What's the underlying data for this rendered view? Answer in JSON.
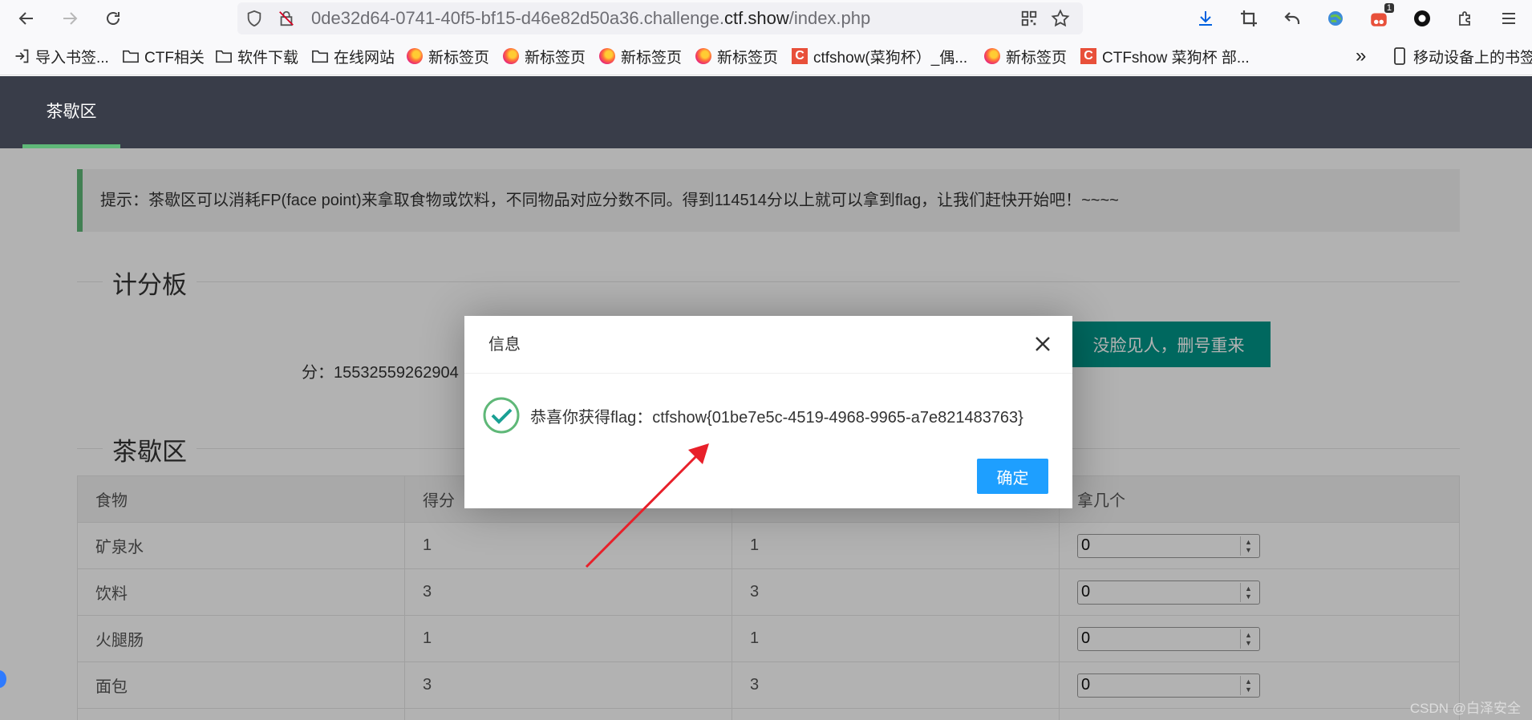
{
  "browser": {
    "url_prefix": "0de32d64-0741-40f5-bf15-d46e82d50a36.challenge.",
    "url_domain": "ctf.show",
    "url_path": "/index.php",
    "extension_badge": "1"
  },
  "bookmarks": {
    "items": [
      {
        "label": "导入书签...",
        "icon": "import-icon"
      },
      {
        "label": "CTF相关",
        "icon": "folder-icon"
      },
      {
        "label": "软件下载",
        "icon": "folder-icon"
      },
      {
        "label": "在线网站",
        "icon": "folder-icon"
      },
      {
        "label": "新标签页",
        "icon": "firefox-icon"
      },
      {
        "label": "新标签页",
        "icon": "firefox-icon"
      },
      {
        "label": "新标签页",
        "icon": "firefox-icon"
      },
      {
        "label": "新标签页",
        "icon": "firefox-icon"
      },
      {
        "label": "ctfshow(菜狗杯）_偶...",
        "icon": "ctfshow-icon"
      },
      {
        "label": "新标签页",
        "icon": "firefox-icon"
      },
      {
        "label": "CTFshow 菜狗杯 部...",
        "icon": "ctfshow-icon"
      }
    ],
    "overflow": "»",
    "mobile_label": "移动设备上的书签"
  },
  "header": {
    "nav_item": "茶歇区"
  },
  "tip": {
    "text": "提示：茶歇区可以消耗FP(face point)来拿取食物或饮料，不同物品对应分数不同。得到114514分以上就可以拿到flag，让我们赶快开始吧！~~~~"
  },
  "scoreboard": {
    "legend": "计分板",
    "score_text": "分：15532559262904",
    "reset_button": "没脸见人，删号重来"
  },
  "menu": {
    "legend": "茶歇区",
    "columns": [
      "食物",
      "得分",
      "",
      "拿几个"
    ],
    "rows": [
      {
        "name": "矿泉水",
        "score": "1",
        "cost": "1",
        "qty": "0"
      },
      {
        "name": "饮料",
        "score": "3",
        "cost": "3",
        "qty": "0"
      },
      {
        "name": "火腿肠",
        "score": "1",
        "cost": "1",
        "qty": "0"
      },
      {
        "name": "面包",
        "score": "3",
        "cost": "3",
        "qty": "0"
      }
    ]
  },
  "dialog": {
    "title": "信息",
    "message": "恭喜你获得flag：ctfshow{01be7e5c-4519-4968-9965-a7e821483763}",
    "ok_button": "确定"
  },
  "watermark": "CSDN @白泽安全",
  "colors": {
    "header_bg": "#393d49",
    "accent_green": "#5fb878",
    "teal_button": "#009688",
    "ok_button": "#1e9fff",
    "arrow": "#e8202a"
  }
}
